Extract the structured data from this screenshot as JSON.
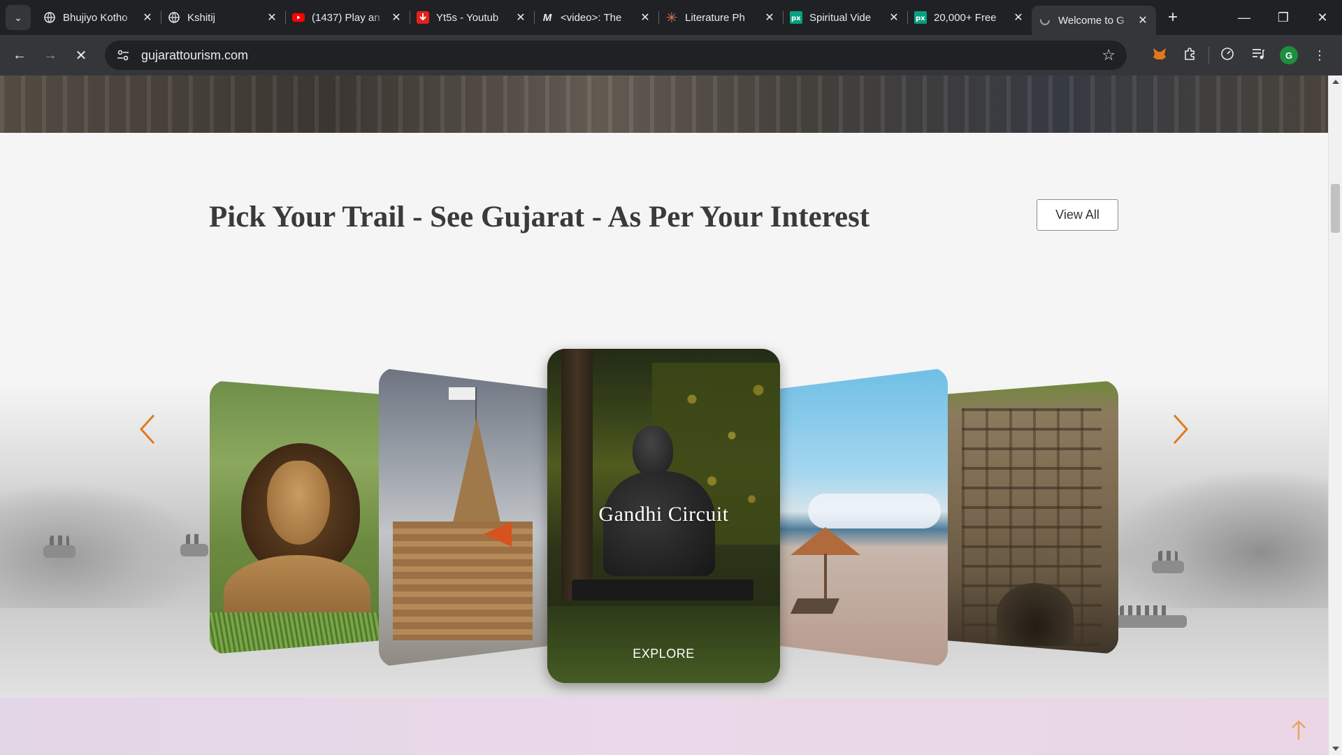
{
  "browser": {
    "tabs": [
      {
        "title": "Bhujiyo Kotho",
        "icon": "globe-icon"
      },
      {
        "title": "Kshitij",
        "icon": "globe-icon"
      },
      {
        "title": "(1437) Play an",
        "icon": "youtube-icon"
      },
      {
        "title": "Yt5s - Youtub",
        "icon": "download-icon"
      },
      {
        "title": "<video>: The",
        "icon": "mdn-icon"
      },
      {
        "title": "Literature Ph",
        "icon": "asterisk-icon"
      },
      {
        "title": "Spiritual Vide",
        "icon": "pexels-icon"
      },
      {
        "title": "20,000+ Free",
        "icon": "pexels-icon"
      },
      {
        "title": "Welcome to G",
        "icon": "loading-icon",
        "active": true
      }
    ],
    "url": "gujarattourism.com",
    "profile_initial": "G",
    "accent_colors": {
      "youtube": "#ff0000",
      "pexels": "#05a081",
      "profile": "#1e8e3e"
    }
  },
  "page": {
    "section_title": "Pick Your Trail - See Gujarat - As Per Your Interest",
    "view_all_label": "View All",
    "carousel": {
      "active_card": {
        "title": "Gandhi Circuit",
        "cta": "EXPLORE"
      },
      "cards": [
        "wildlife-lion",
        "temple-dwarka",
        "gandhi-circuit",
        "beach",
        "stepwell"
      ]
    },
    "arrow_color": "#e07a1f"
  }
}
